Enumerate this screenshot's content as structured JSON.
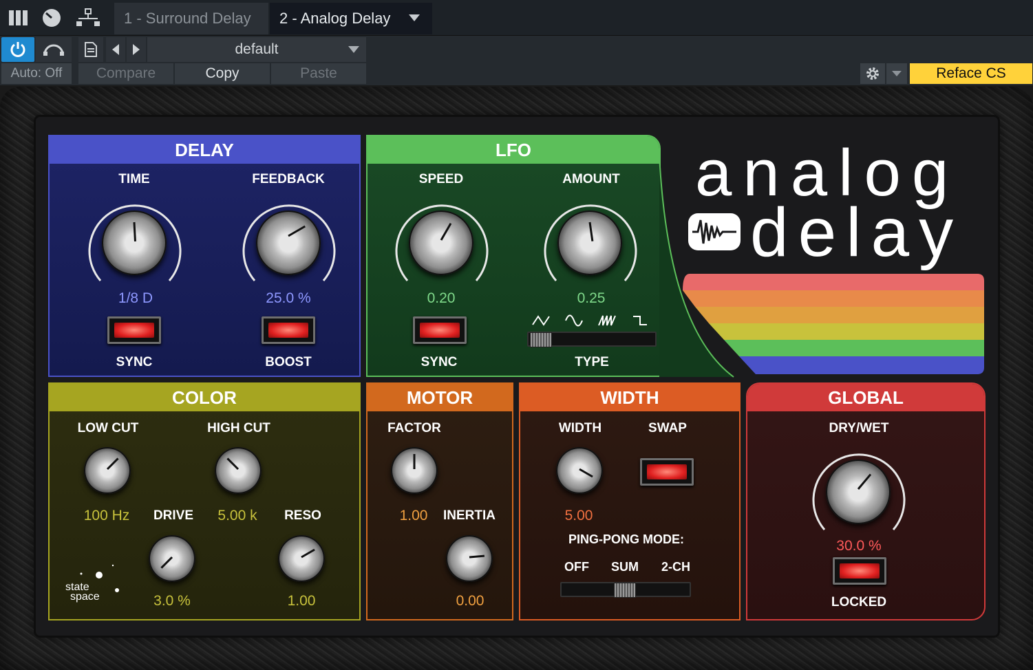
{
  "host": {
    "tabs": [
      "1 - Surround Delay",
      "2 - Analog Delay"
    ],
    "automation": "Auto: Off",
    "preset": "default",
    "compare_label": "Compare",
    "copy_label": "Copy",
    "paste_label": "Paste",
    "device": "Reface CS"
  },
  "logo": {
    "line1": "analog",
    "line2": "delay"
  },
  "delay": {
    "title": "DELAY",
    "time_label": "TIME",
    "time_value": "1/8 D",
    "feedback_label": "FEEDBACK",
    "feedback_value": "25.0 %",
    "sync_label": "SYNC",
    "boost_label": "BOOST"
  },
  "lfo": {
    "title": "LFO",
    "speed_label": "SPEED",
    "speed_value": "0.20",
    "amount_label": "AMOUNT",
    "amount_value": "0.25",
    "sync_label": "SYNC",
    "type_label": "TYPE",
    "type_shapes": [
      "triangle-icon",
      "sine-icon",
      "saw-icon",
      "square-icon"
    ]
  },
  "color": {
    "title": "COLOR",
    "lowcut_label": "LOW CUT",
    "lowcut_value": "100 Hz",
    "highcut_label": "HIGH CUT",
    "highcut_value": "5.00 k",
    "drive_label": "DRIVE",
    "drive_value": "3.0 %",
    "reso_label": "RESO",
    "reso_value": "1.00",
    "brand_line1": "state",
    "brand_line2": "space"
  },
  "motor": {
    "title": "MOTOR",
    "factor_label": "FACTOR",
    "factor_value": "1.00",
    "inertia_label": "INERTIA",
    "inertia_value": "0.00"
  },
  "width": {
    "title": "WIDTH",
    "width_label": "WIDTH",
    "width_value": "5.00",
    "swap_label": "SWAP",
    "pingpong_label": "PING-PONG MODE:",
    "modes": [
      "OFF",
      "SUM",
      "2-CH"
    ]
  },
  "global": {
    "title": "GLOBAL",
    "drywet_label": "DRY/WET",
    "drywet_value": "30.0 %",
    "locked_label": "LOCKED"
  },
  "colors": {
    "delay": "#4a52c8",
    "lfo": "#5cbf5a",
    "color": "#a6a521",
    "motor": "#d2691e",
    "width": "#dc5c24",
    "global": "#d03a3a",
    "accent": "#ffd23a",
    "stripes": [
      "#e86a6a",
      "#e88a4a",
      "#e0a040",
      "#c8c23c",
      "#5cbf5a",
      "#4a52c8"
    ]
  }
}
